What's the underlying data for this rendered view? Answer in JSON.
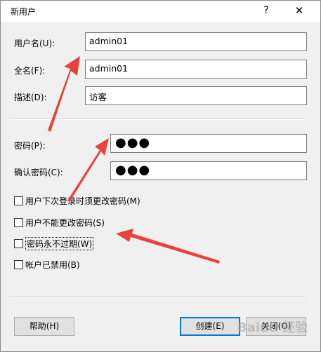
{
  "window": {
    "title": "新用户",
    "help_glyph": "?",
    "close_glyph": "✕"
  },
  "form": {
    "username_label": "用户名(U):",
    "username_value": "admin01",
    "fullname_label": "全名(F):",
    "fullname_value": "admin01",
    "description_label": "描述(D):",
    "description_value": "访客",
    "password_label": "密码(P):",
    "password_value": "●●●",
    "confirm_label": "确认密码(C):",
    "confirm_value": "●●●"
  },
  "options": [
    {
      "label": "用户下次登录时须更改密码(M)",
      "checked": false
    },
    {
      "label": "用户不能更改密码(S)",
      "checked": false
    },
    {
      "label": "密码永不过期(W)",
      "checked": false
    },
    {
      "label": "帐户已禁用(B)",
      "checked": false
    }
  ],
  "buttons": {
    "help": "帮助(H)",
    "create": "创建(E)",
    "close": "关闭(O)"
  },
  "watermark": "Baidu 经验",
  "colors": {
    "annotation_arrow": "#e8423b",
    "default_button_border": "#0078d7"
  }
}
